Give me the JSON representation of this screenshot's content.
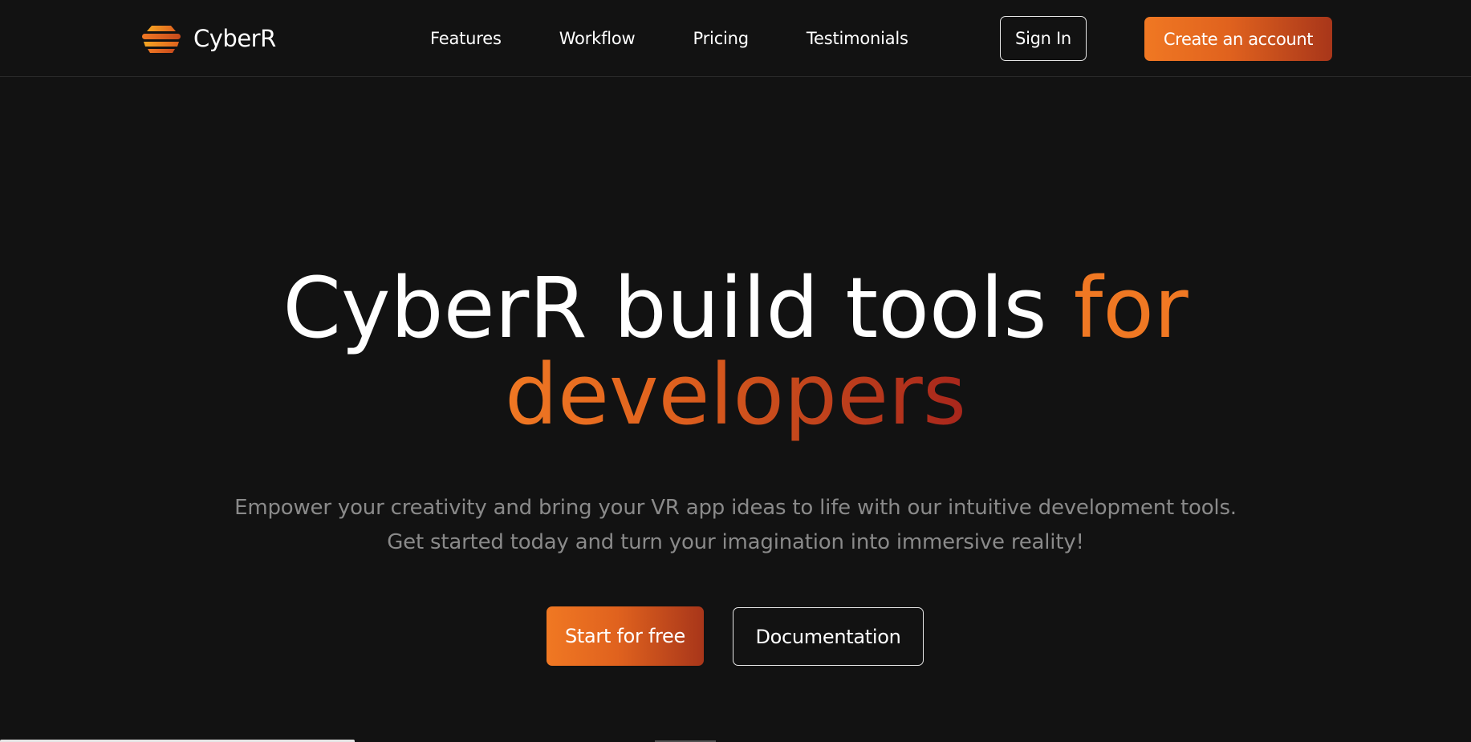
{
  "brand": {
    "name": "CyberR",
    "logo_icon": "layered-dome-logo-icon",
    "logo_colors": [
      "#f07823",
      "#f5a623",
      "#e0621e"
    ]
  },
  "nav": {
    "items": [
      {
        "label": "Features"
      },
      {
        "label": "Workflow"
      },
      {
        "label": "Pricing"
      },
      {
        "label": "Testimonials"
      }
    ]
  },
  "header_actions": {
    "sign_in": "Sign In",
    "create_account": "Create an account"
  },
  "hero": {
    "title_part1": "CyberR build tools ",
    "title_part2": "for",
    "title_part3": "developers",
    "subtitle_line1": "Empower your creativity and bring your VR app ideas to life with our intuitive development tools.",
    "subtitle_line2": "Get started today and turn your imagination into immersive reality!",
    "primary_cta": "Start for free",
    "secondary_cta": "Documentation"
  },
  "theme": {
    "background": "#121212",
    "accent_start": "#f07823",
    "accent_end": "#a8261c",
    "muted_text": "#8a8a8a"
  }
}
